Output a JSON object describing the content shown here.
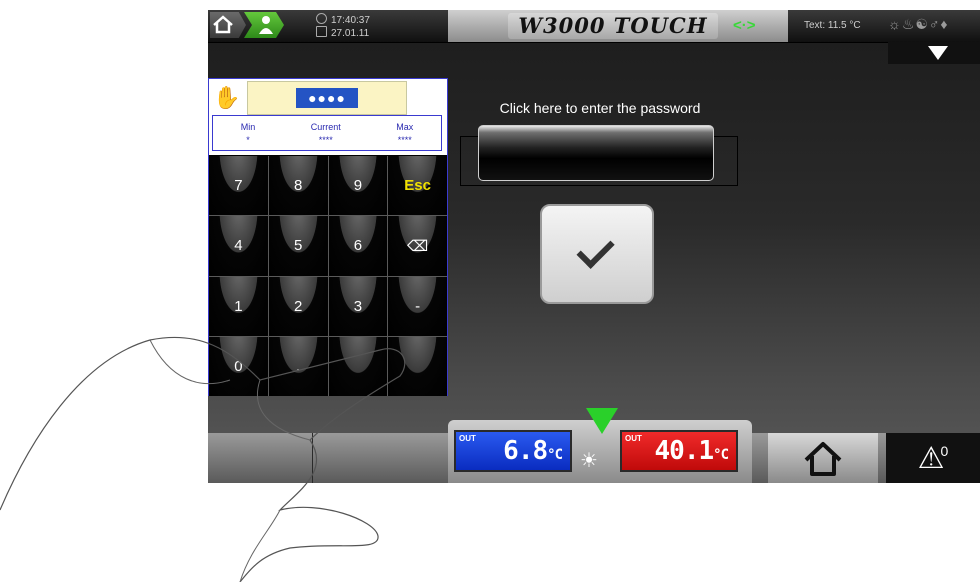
{
  "topbar": {
    "time": "17:40:37",
    "date": "27.01.11",
    "brand": "W3000 TOUCH",
    "ext_temp": "Text: 11.5 °C"
  },
  "keypad": {
    "password_display": "●●●●",
    "min_label": "Min",
    "min_value": "*",
    "current_label": "Current",
    "current_value": "****",
    "max_label": "Max",
    "max_value": "****",
    "keys": [
      "7",
      "8",
      "9",
      "Esc",
      "4",
      "5",
      "6",
      "⌫",
      "1",
      "2",
      "3",
      "-",
      "0",
      ".",
      "",
      ""
    ]
  },
  "main": {
    "prompt": "Click here to enter the password"
  },
  "bottom": {
    "out_blue_label": "OUT",
    "out_blue_value": "6.8",
    "out_blue_unit": "°C",
    "out_red_label": "OUT",
    "out_red_value": "40.1",
    "out_red_unit": "°C",
    "alarm_count": "0"
  }
}
